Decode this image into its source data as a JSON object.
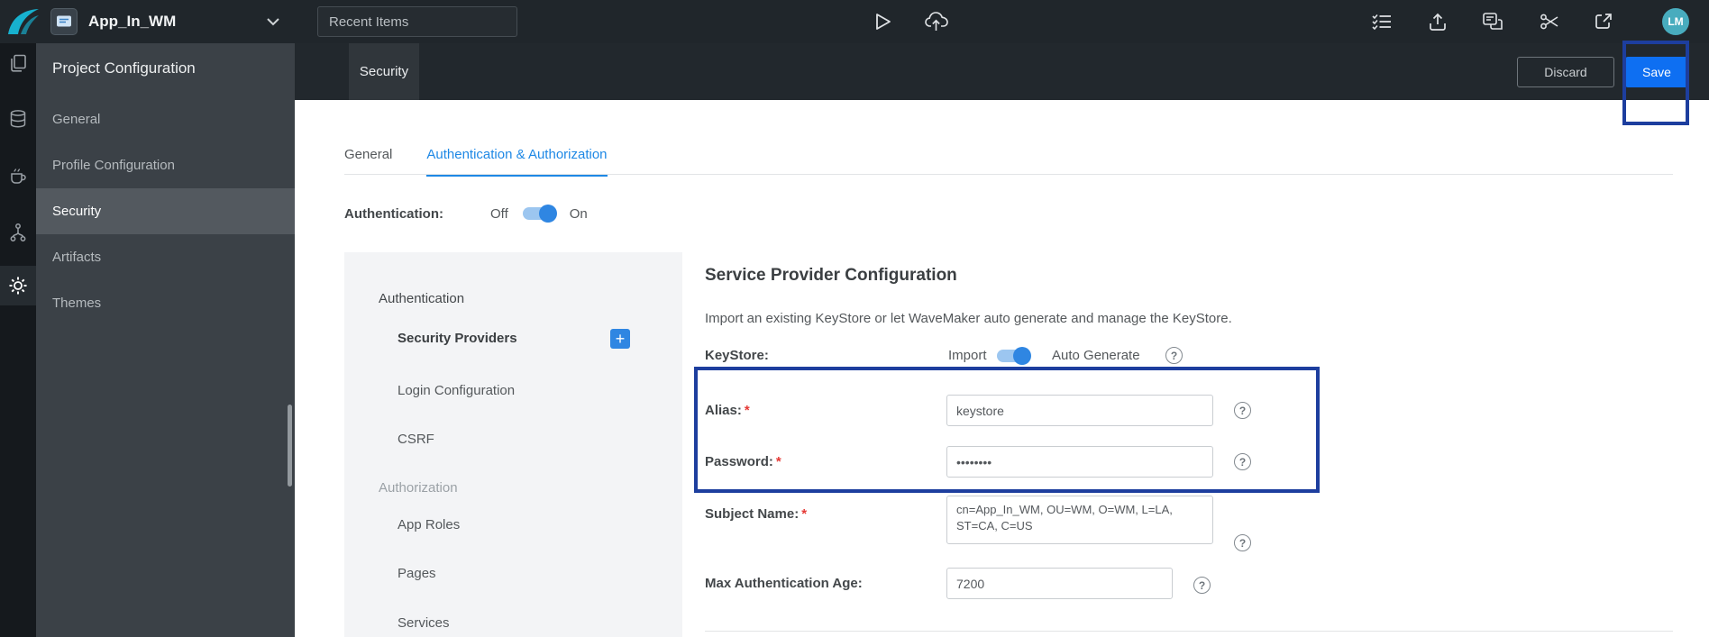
{
  "topbar": {
    "app_title": "App_In_WM",
    "recent_items_placeholder": "Recent Items",
    "avatar_initials": "LM"
  },
  "sidebar": {
    "title": "Project Configuration",
    "items": [
      {
        "label": "General"
      },
      {
        "label": "Profile Configuration"
      },
      {
        "label": "Security"
      },
      {
        "label": "Artifacts"
      },
      {
        "label": "Themes"
      }
    ]
  },
  "tabstrip": {
    "tab": "Security",
    "discard": "Discard",
    "save": "Save"
  },
  "content": {
    "tabs": [
      {
        "label": "General"
      },
      {
        "label": "Authentication & Authorization"
      }
    ],
    "authentication_label": "Authentication:",
    "off": "Off",
    "on": "On",
    "subnav": {
      "auth_header": "Authentication",
      "security_providers": "Security Providers",
      "login_configuration": "Login Configuration",
      "csrf": "CSRF",
      "authz_header": "Authorization",
      "app_roles": "App Roles",
      "pages": "Pages",
      "services": "Services"
    },
    "form": {
      "title": "Service Provider Configuration",
      "description": "Import an existing KeyStore or let WaveMaker auto generate and manage the KeyStore.",
      "keystore_label": "KeyStore:",
      "import_label": "Import",
      "auto_generate_label": "Auto Generate",
      "alias_label": "Alias:",
      "alias_value": "keystore",
      "password_label": "Password:",
      "password_value": "••••••••",
      "subject_label": "Subject Name:",
      "subject_value": "cn=App_In_WM, OU=WM, O=WM, L=LA, ST=CA, C=US",
      "max_age_label": "Max Authentication Age:",
      "max_age_value": "7200",
      "required_marker": "*"
    }
  },
  "icons": {
    "help": "?",
    "add": "+"
  },
  "colors": {
    "accent_blue": "#1e88e5",
    "save_blue": "#0e6ff2",
    "annotation_blue": "#1d3e9e",
    "toggle_knob": "#2f86e2",
    "toggle_track": "#9cc6f0",
    "logo_teal": "#17b1cf",
    "avatar_teal": "#48acbe",
    "asterisk_red": "#e53935"
  }
}
